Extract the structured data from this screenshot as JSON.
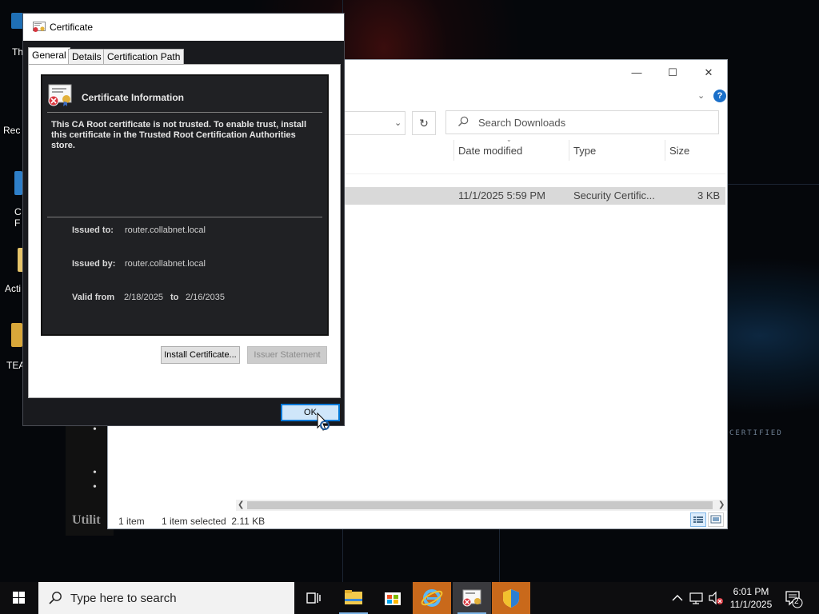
{
  "desktop": {
    "icons": [
      {
        "label": "Th"
      },
      {
        "label": "Rec"
      },
      {
        "label": "C\nF"
      },
      {
        "label": "Acti"
      },
      {
        "label": "TEA"
      }
    ],
    "document_text": "Utilit",
    "badge_text": "CERTIFIED"
  },
  "explorer": {
    "search_placeholder": "Search Downloads",
    "columns": [
      "Date modified",
      "Type",
      "Size"
    ],
    "rows": [
      {
        "date": "11/1/2025 5:59 PM",
        "type": "Security Certific...",
        "size": "3 KB"
      }
    ],
    "status_items": "1 item",
    "status_selected": "1 item selected  2.11 KB"
  },
  "certificate": {
    "title": "Certificate",
    "tabs": [
      "General",
      "Details",
      "Certification Path"
    ],
    "active_tab": "General",
    "info_heading": "Certificate Information",
    "info_text": "This CA Root certificate is not trusted. To enable trust, install this certificate in the Trusted Root Certification Authorities store.",
    "issued_to_label": "Issued to:",
    "issued_to": "router.collabnet.local",
    "issued_by_label": "Issued by:",
    "issued_by": "router.collabnet.local",
    "valid_from_label": "Valid from",
    "valid_from": "2/18/2025",
    "to_label": "to",
    "valid_to": "2/16/2035",
    "install_button": "Install Certificate...",
    "issuer_button": "Issuer Statement",
    "ok_button": "OK"
  },
  "taskbar": {
    "search_placeholder": "Type here to search",
    "time": "6:01 PM",
    "date": "11/1/2025",
    "notification_count": "2"
  },
  "colors": {
    "accent": "#0078d7",
    "taskbar_highlight": "#c9691b",
    "dialog_dark": "#202124"
  }
}
